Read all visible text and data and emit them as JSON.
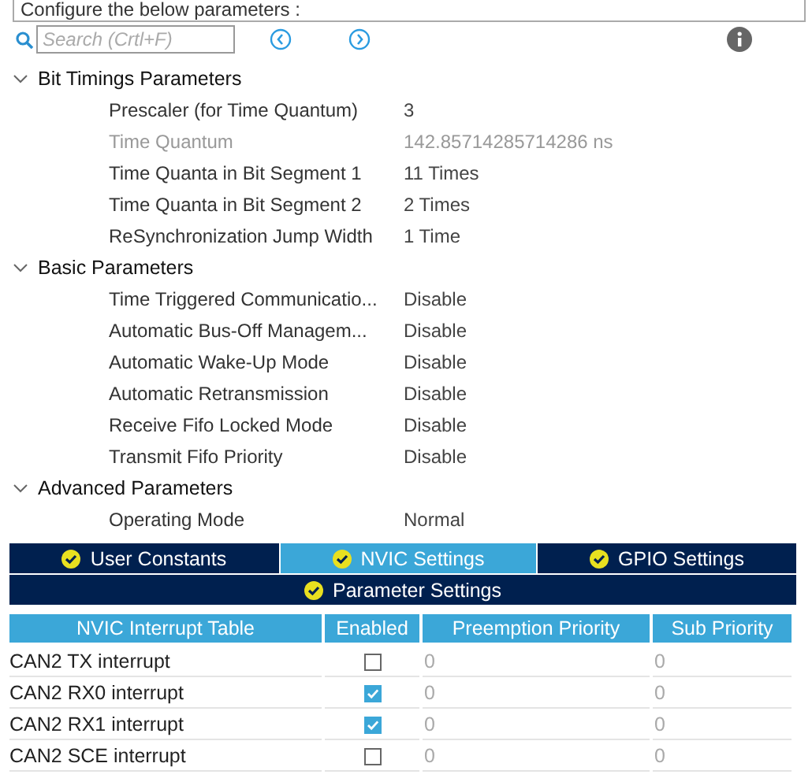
{
  "header": {
    "text": "Configure the below parameters :"
  },
  "search": {
    "placeholder": "Search (Crtl+F)"
  },
  "groups": [
    {
      "title": "Bit Timings Parameters",
      "expanded": true,
      "params": [
        {
          "label": "Prescaler (for Time Quantum)",
          "value": "3",
          "disabled": false
        },
        {
          "label": "Time Quantum",
          "value": "142.85714285714286 ns",
          "disabled": true
        },
        {
          "label": "Time Quanta in Bit Segment 1",
          "value": "11 Times",
          "disabled": false
        },
        {
          "label": "Time Quanta in Bit Segment 2",
          "value": "2 Times",
          "disabled": false
        },
        {
          "label": "ReSynchronization Jump Width",
          "value": "1 Time",
          "disabled": false
        }
      ]
    },
    {
      "title": "Basic Parameters",
      "expanded": true,
      "params": [
        {
          "label": "Time Triggered Communicatio...",
          "value": "Disable",
          "disabled": false
        },
        {
          "label": "Automatic Bus-Off Managem...",
          "value": "Disable",
          "disabled": false
        },
        {
          "label": "Automatic Wake-Up Mode",
          "value": "Disable",
          "disabled": false
        },
        {
          "label": "Automatic Retransmission",
          "value": "Disable",
          "disabled": false
        },
        {
          "label": "Receive Fifo Locked Mode",
          "value": "Disable",
          "disabled": false
        },
        {
          "label": "Transmit Fifo Priority",
          "value": "Disable",
          "disabled": false
        }
      ]
    },
    {
      "title": "Advanced Parameters",
      "expanded": true,
      "params": [
        {
          "label": "Operating Mode",
          "value": "Normal",
          "disabled": false
        }
      ]
    }
  ],
  "tabs": [
    {
      "label": "User Constants",
      "selected": false
    },
    {
      "label": "NVIC Settings",
      "selected": true
    },
    {
      "label": "GPIO Settings",
      "selected": false
    },
    {
      "label": "Parameter Settings",
      "selected": false
    }
  ],
  "nvic_table": {
    "columns": [
      "NVIC Interrupt Table",
      "Enabled",
      "Preemption Priority",
      "Sub Priority"
    ],
    "rows": [
      {
        "name": "CAN2 TX interrupt",
        "enabled": false,
        "preemption_priority": "0",
        "sub_priority": "0"
      },
      {
        "name": "CAN2 RX0 interrupt",
        "enabled": true,
        "preemption_priority": "0",
        "sub_priority": "0"
      },
      {
        "name": "CAN2 RX1 interrupt",
        "enabled": true,
        "preemption_priority": "0",
        "sub_priority": "0"
      },
      {
        "name": "CAN2 SCE interrupt",
        "enabled": false,
        "preemption_priority": "0",
        "sub_priority": "0"
      }
    ]
  }
}
